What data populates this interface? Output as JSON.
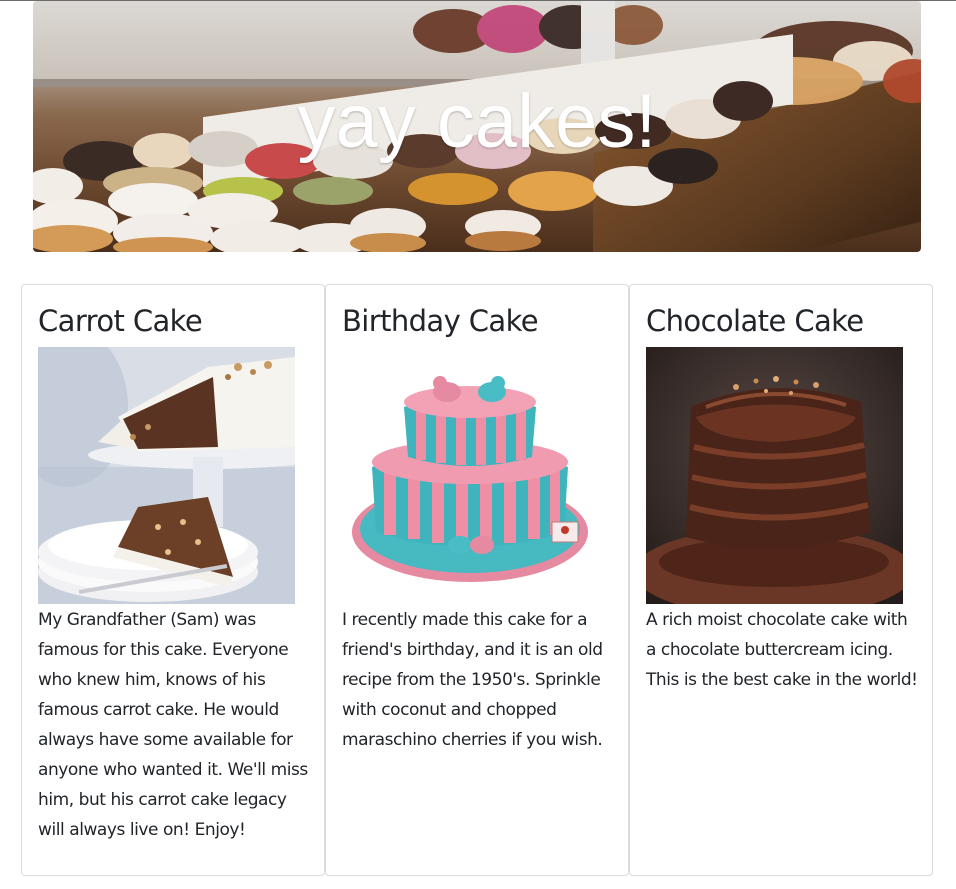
{
  "hero": {
    "title": "yay cakes!"
  },
  "cards": [
    {
      "title": "Carrot Cake",
      "image": "carrot-cake-photo",
      "text": "My Grandfather (Sam) was famous for this cake. Everyone who knew him, knows of his famous carrot cake. He would always have some available for anyone who wanted it. We'll miss him, but his carrot cake legacy will always live on! Enjoy!"
    },
    {
      "title": "Birthday Cake",
      "image": "birthday-cake-photo",
      "text": "I recently made this cake for a friend's birthday, and it is an old recipe from the 1950's. Sprinkle with coconut and chopped maraschino cherries if you wish."
    },
    {
      "title": "Chocolate Cake",
      "image": "chocolate-cake-photo",
      "text": "A rich moist chocolate cake with a chocolate buttercream icing. This is the best cake in the world!"
    }
  ],
  "colors": {
    "text": "#212529",
    "card_border": "#dcdcdc",
    "hero_text": "#ffffff"
  }
}
